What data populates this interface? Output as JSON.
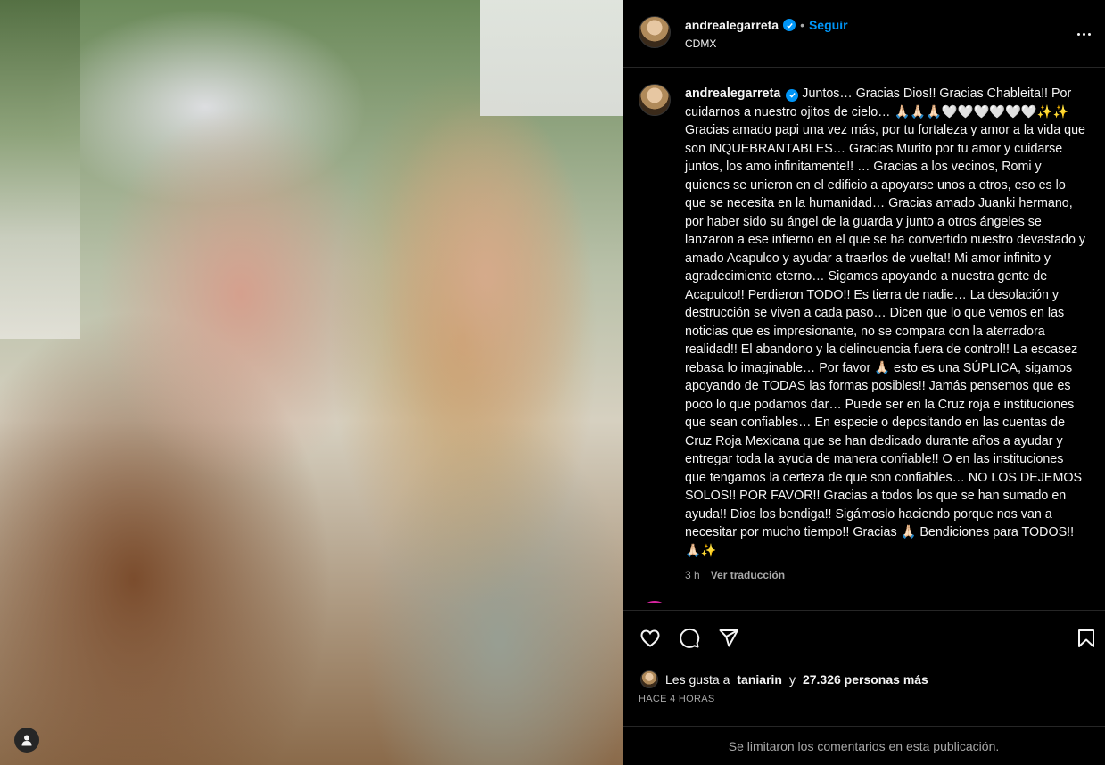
{
  "post": {
    "username": "andrealegarreta",
    "follow_label": "Seguir",
    "separator": "•",
    "location": "CDMX",
    "caption": "Juntos… Gracias Dios!! Gracias Chableita!! Por cuidarnos a nuestro ojitos de cielo… 🙏🏻🙏🏻🙏🏻🤍🤍🤍🤍🤍🤍✨✨ Gracias amado papi una vez más, por tu fortaleza y amor a la vida que son INQUEBRANTABLES… Gracias Murito por tu amor y cuidarse juntos, los amo infinitamente!! … Gracias a los vecinos, Romi y quienes se unieron en el edificio a apoyarse unos a otros, eso es lo que se necesita en la humanidad… Gracias amado Juanki hermano, por haber sido su ángel de la guarda y junto a otros ángeles se lanzaron a ese infierno en el que se ha convertido nuestro devastado y amado Acapulco y ayudar a traerlos de vuelta!! Mi amor infinito y agradecimiento eterno… Sigamos apoyando a nuestra gente de Acapulco!! Perdieron TODO!! Es tierra de nadie… La desolación y destrucción se viven a cada paso… Dicen que lo que vemos en las noticias que es impresionante, no se compara con la aterradora realidad!! El abandono y la delincuencia fuera de control!! La escasez rebasa lo imaginable… Por favor 🙏🏻 esto es una SÚPLICA, sigamos apoyando de TODAS las formas posibles!! Jamás pensemos que es poco lo que podamos dar… Puede ser en la Cruz roja e instituciones que sean confiables… En especie o depositando en las cuentas de Cruz Roja Mexicana que se han dedicado durante años a ayudar y entregar toda la ayuda de manera confiable!! O en las instituciones que tengamos la certeza de que son confiables… NO LOS DEJEMOS SOLOS!! POR FAVOR!! Gracias a todos los que se han sumado en ayuda!! Dios los bendiga!! Sigámoslo haciendo porque nos van a necesitar por mucho tiempo!! Gracias 🙏🏻 Bendiciones para TODOS!! 🙏🏻✨",
    "caption_time": "3 h",
    "translate_label": "Ver traducción",
    "likes_prefix": "Les gusta a",
    "likes_user": "taniarin",
    "likes_joiner": "y",
    "likes_count": "27.326 personas más",
    "time_ago": "HACE 4 HORAS",
    "comments_limited": "Se limitaron los comentarios en esta publicación."
  },
  "icons": {
    "verified": "verified-badge-icon",
    "more": "more-options-icon",
    "like": "heart-icon",
    "comment": "comment-icon",
    "share": "send-icon",
    "save": "bookmark-icon",
    "user_tag": "user-tag-icon"
  },
  "colors": {
    "background": "#000000",
    "text": "#f5f5f5",
    "secondary_text": "#a8a8a8",
    "accent": "#0095f6",
    "divider": "#262626"
  }
}
